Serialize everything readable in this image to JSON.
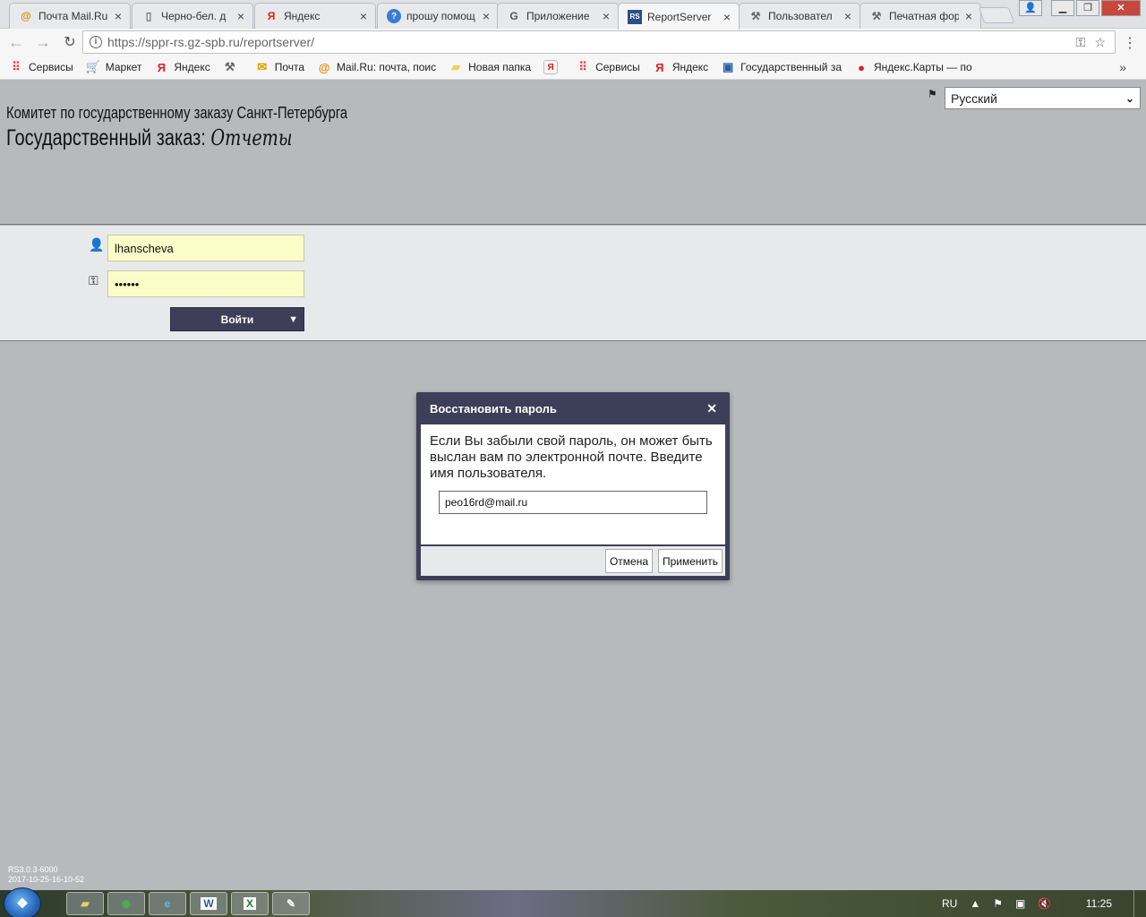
{
  "browser": {
    "tabs": [
      {
        "title": "Почта Mail.Ru",
        "icon": "mailru-icon",
        "active": false
      },
      {
        "title": "Черно-бел. д",
        "icon": "document-icon",
        "active": false
      },
      {
        "title": "Яндекс",
        "icon": "yandex-icon",
        "active": false
      },
      {
        "title": "прошу помощ",
        "icon": "help-icon",
        "active": false
      },
      {
        "title": "Приложение",
        "icon": "google-icon",
        "active": false
      },
      {
        "title": "ReportServer",
        "icon": "reportserver-icon",
        "active": true
      },
      {
        "title": "Пользовател",
        "icon": "tools-icon",
        "active": false
      },
      {
        "title": "Печатная фор",
        "icon": "tools-icon",
        "active": false
      }
    ],
    "url": "https://sppr-rs.gz-spb.ru/reportserver/",
    "bookmarks": [
      {
        "label": "Сервисы",
        "icon": "apps-grid-icon"
      },
      {
        "label": "Маркет",
        "icon": "cart-icon"
      },
      {
        "label": "Яндекс",
        "icon": "yandex-icon"
      },
      {
        "label": "",
        "icon": "tools-icon"
      },
      {
        "label": "Почта",
        "icon": "mail-envelope-icon"
      },
      {
        "label": "Mail.Ru: почта, поис",
        "icon": "mailru-icon"
      },
      {
        "label": "Новая папка",
        "icon": "folder-icon"
      },
      {
        "label": "",
        "icon": "yandex-browser-icon"
      },
      {
        "label": "Сервисы",
        "icon": "apps-grid-icon"
      },
      {
        "label": "Яндекс",
        "icon": "yandex-icon"
      },
      {
        "label": "Государственный за",
        "icon": "gov-icon"
      },
      {
        "label": "Яндекс.Карты — по",
        "icon": "map-pin-icon"
      }
    ],
    "more_bookmarks": "»"
  },
  "page": {
    "org_title": "Комитет по государственному заказу Санкт-Петербурга",
    "app_title": "Государственный заказ:",
    "app_subtitle": "Отчеты",
    "language": "Русский",
    "username_value": "lhanscheva",
    "password_value": "••••••",
    "login_button": "Войти"
  },
  "dialog": {
    "title": "Восстановить пароль",
    "message": "Если Вы забыли свой пароль, он может быть выслан вам по электронной почте. Введите имя пользователя.",
    "input_value": "peo16rd@mail.ru",
    "cancel_label": "Отмена",
    "apply_label": "Применить"
  },
  "version": {
    "line1": "RS3.0.3-6000",
    "line2": "2017-10-25-16-10-52"
  },
  "taskbar": {
    "language": "RU",
    "clock": "11:25"
  },
  "colors": {
    "page_bg": "#b7babc",
    "band_bg": "#e8e9eb",
    "accent": "#3d3e58",
    "input_yellow": "#fbfdc8"
  }
}
